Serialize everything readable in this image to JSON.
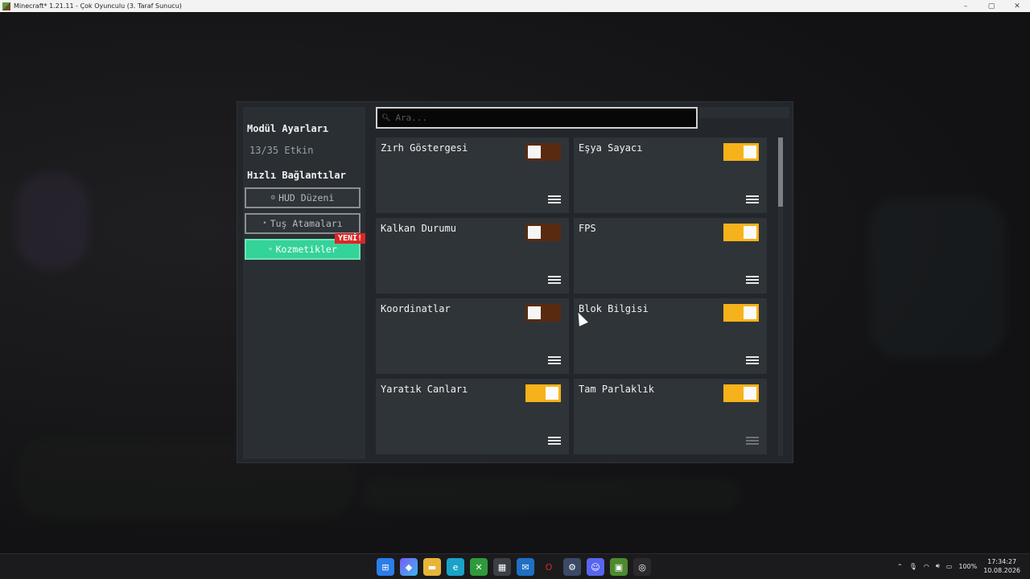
{
  "window": {
    "title": "Minecraft* 1.21.11 - Çok Oyunculu (3. Taraf Sunucu)",
    "controls": [
      "–",
      "▢",
      "✕"
    ]
  },
  "sidebar": {
    "title": "Modül Ayarları",
    "count": "13/35 Etkin",
    "quick_links_title": "Hızlı Bağlantılar",
    "buttons": [
      {
        "label": "HUD Düzeni",
        "icon": "gear-icon",
        "active": false
      },
      {
        "label": "Tuş Atamaları",
        "icon": "dot-icon",
        "active": false
      },
      {
        "label": "Kozmetikler",
        "icon": "sparkle-icon",
        "active": true
      }
    ],
    "new_badge": "YENİ!"
  },
  "search": {
    "placeholder": "Ara...",
    "value": ""
  },
  "modules": [
    {
      "name": "Zırh Göstergesi",
      "enabled": false
    },
    {
      "name": "Eşya Sayacı",
      "enabled": true
    },
    {
      "name": "Kalkan Durumu",
      "enabled": false
    },
    {
      "name": "FPS",
      "enabled": true
    },
    {
      "name": "Koordinatlar",
      "enabled": false
    },
    {
      "name": "Blok Bilgisi",
      "enabled": true
    },
    {
      "name": "Yaratık Canları",
      "enabled": true
    },
    {
      "name": "Tam Parlaklık",
      "enabled": true
    }
  ],
  "colors": {
    "toggle_on": "#f6b21a",
    "toggle_off": "#5a2a10",
    "active_button": "#34d399",
    "badge": "#dc2626"
  },
  "taskbar": {
    "apps": [
      "windows-start-icon",
      "copilot-icon",
      "file-explorer-icon",
      "edge-icon",
      "xbox-icon",
      "store-icon",
      "mail-icon",
      "opera-icon",
      "steam-icon",
      "discord-icon",
      "minecraft-icon",
      "app-icon"
    ],
    "battery": "100%",
    "time": "17:34:27",
    "date": "10.08.2026"
  }
}
